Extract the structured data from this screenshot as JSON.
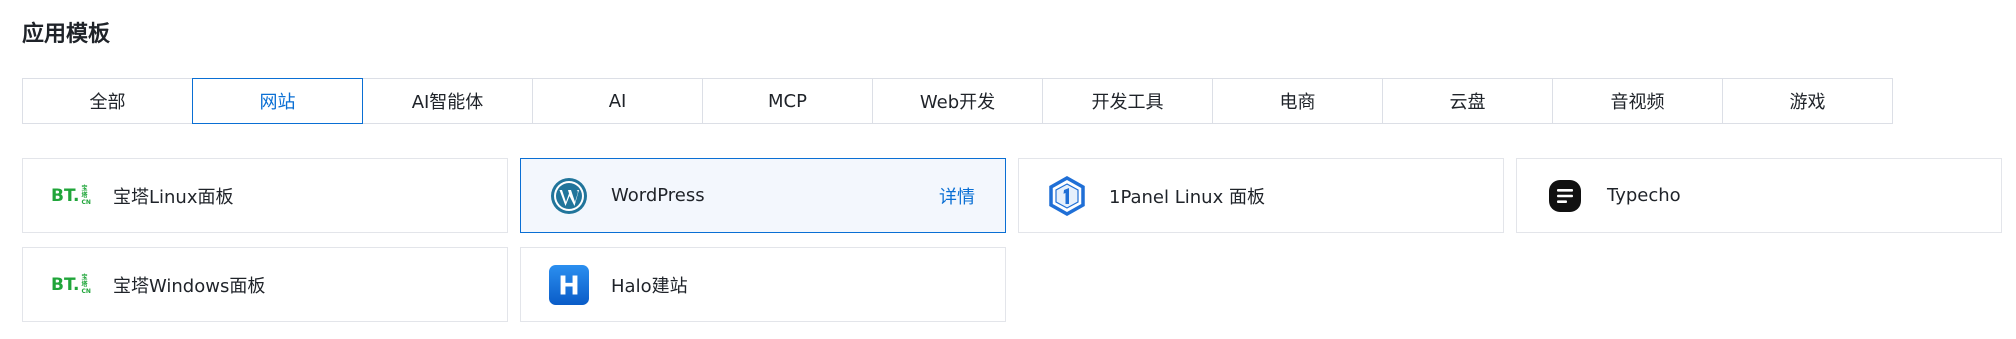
{
  "section": {
    "title": "应用模板"
  },
  "tabs": [
    {
      "label": "全部"
    },
    {
      "label": "网站"
    },
    {
      "label": "AI智能体"
    },
    {
      "label": "AI"
    },
    {
      "label": "MCP"
    },
    {
      "label": "Web开发"
    },
    {
      "label": "开发工具"
    },
    {
      "label": "电商"
    },
    {
      "label": "云盘"
    },
    {
      "label": "音视频"
    },
    {
      "label": "游戏"
    }
  ],
  "active_tab": "网站",
  "templates": [
    {
      "name": "宝塔Linux面板",
      "icon": "bt-panel-icon",
      "logo_text": "BT.",
      "logo_small_top": "宝塔",
      "logo_small_bottom": "CN"
    },
    {
      "name": "WordPress",
      "icon": "wordpress-icon",
      "detail": "详情"
    },
    {
      "name": "1Panel Linux 面板",
      "icon": "1panel-icon"
    },
    {
      "name": "Typecho",
      "icon": "typecho-icon"
    },
    {
      "name": "宝塔Windows面板",
      "icon": "bt-panel-icon",
      "logo_text": "BT.",
      "logo_small_top": "宝塔",
      "logo_small_bottom": "CN"
    },
    {
      "name": "Halo建站",
      "icon": "halo-icon",
      "logo_text": "H"
    }
  ],
  "colors": {
    "accent": "#0a6fd4",
    "active_card_bg": "#f3f7fd",
    "bt_green": "#20a53a",
    "wordpress_blue": "#21759b",
    "onepanel_blue": "#1f6fd6",
    "halo_blue": "#0a6fd4"
  }
}
